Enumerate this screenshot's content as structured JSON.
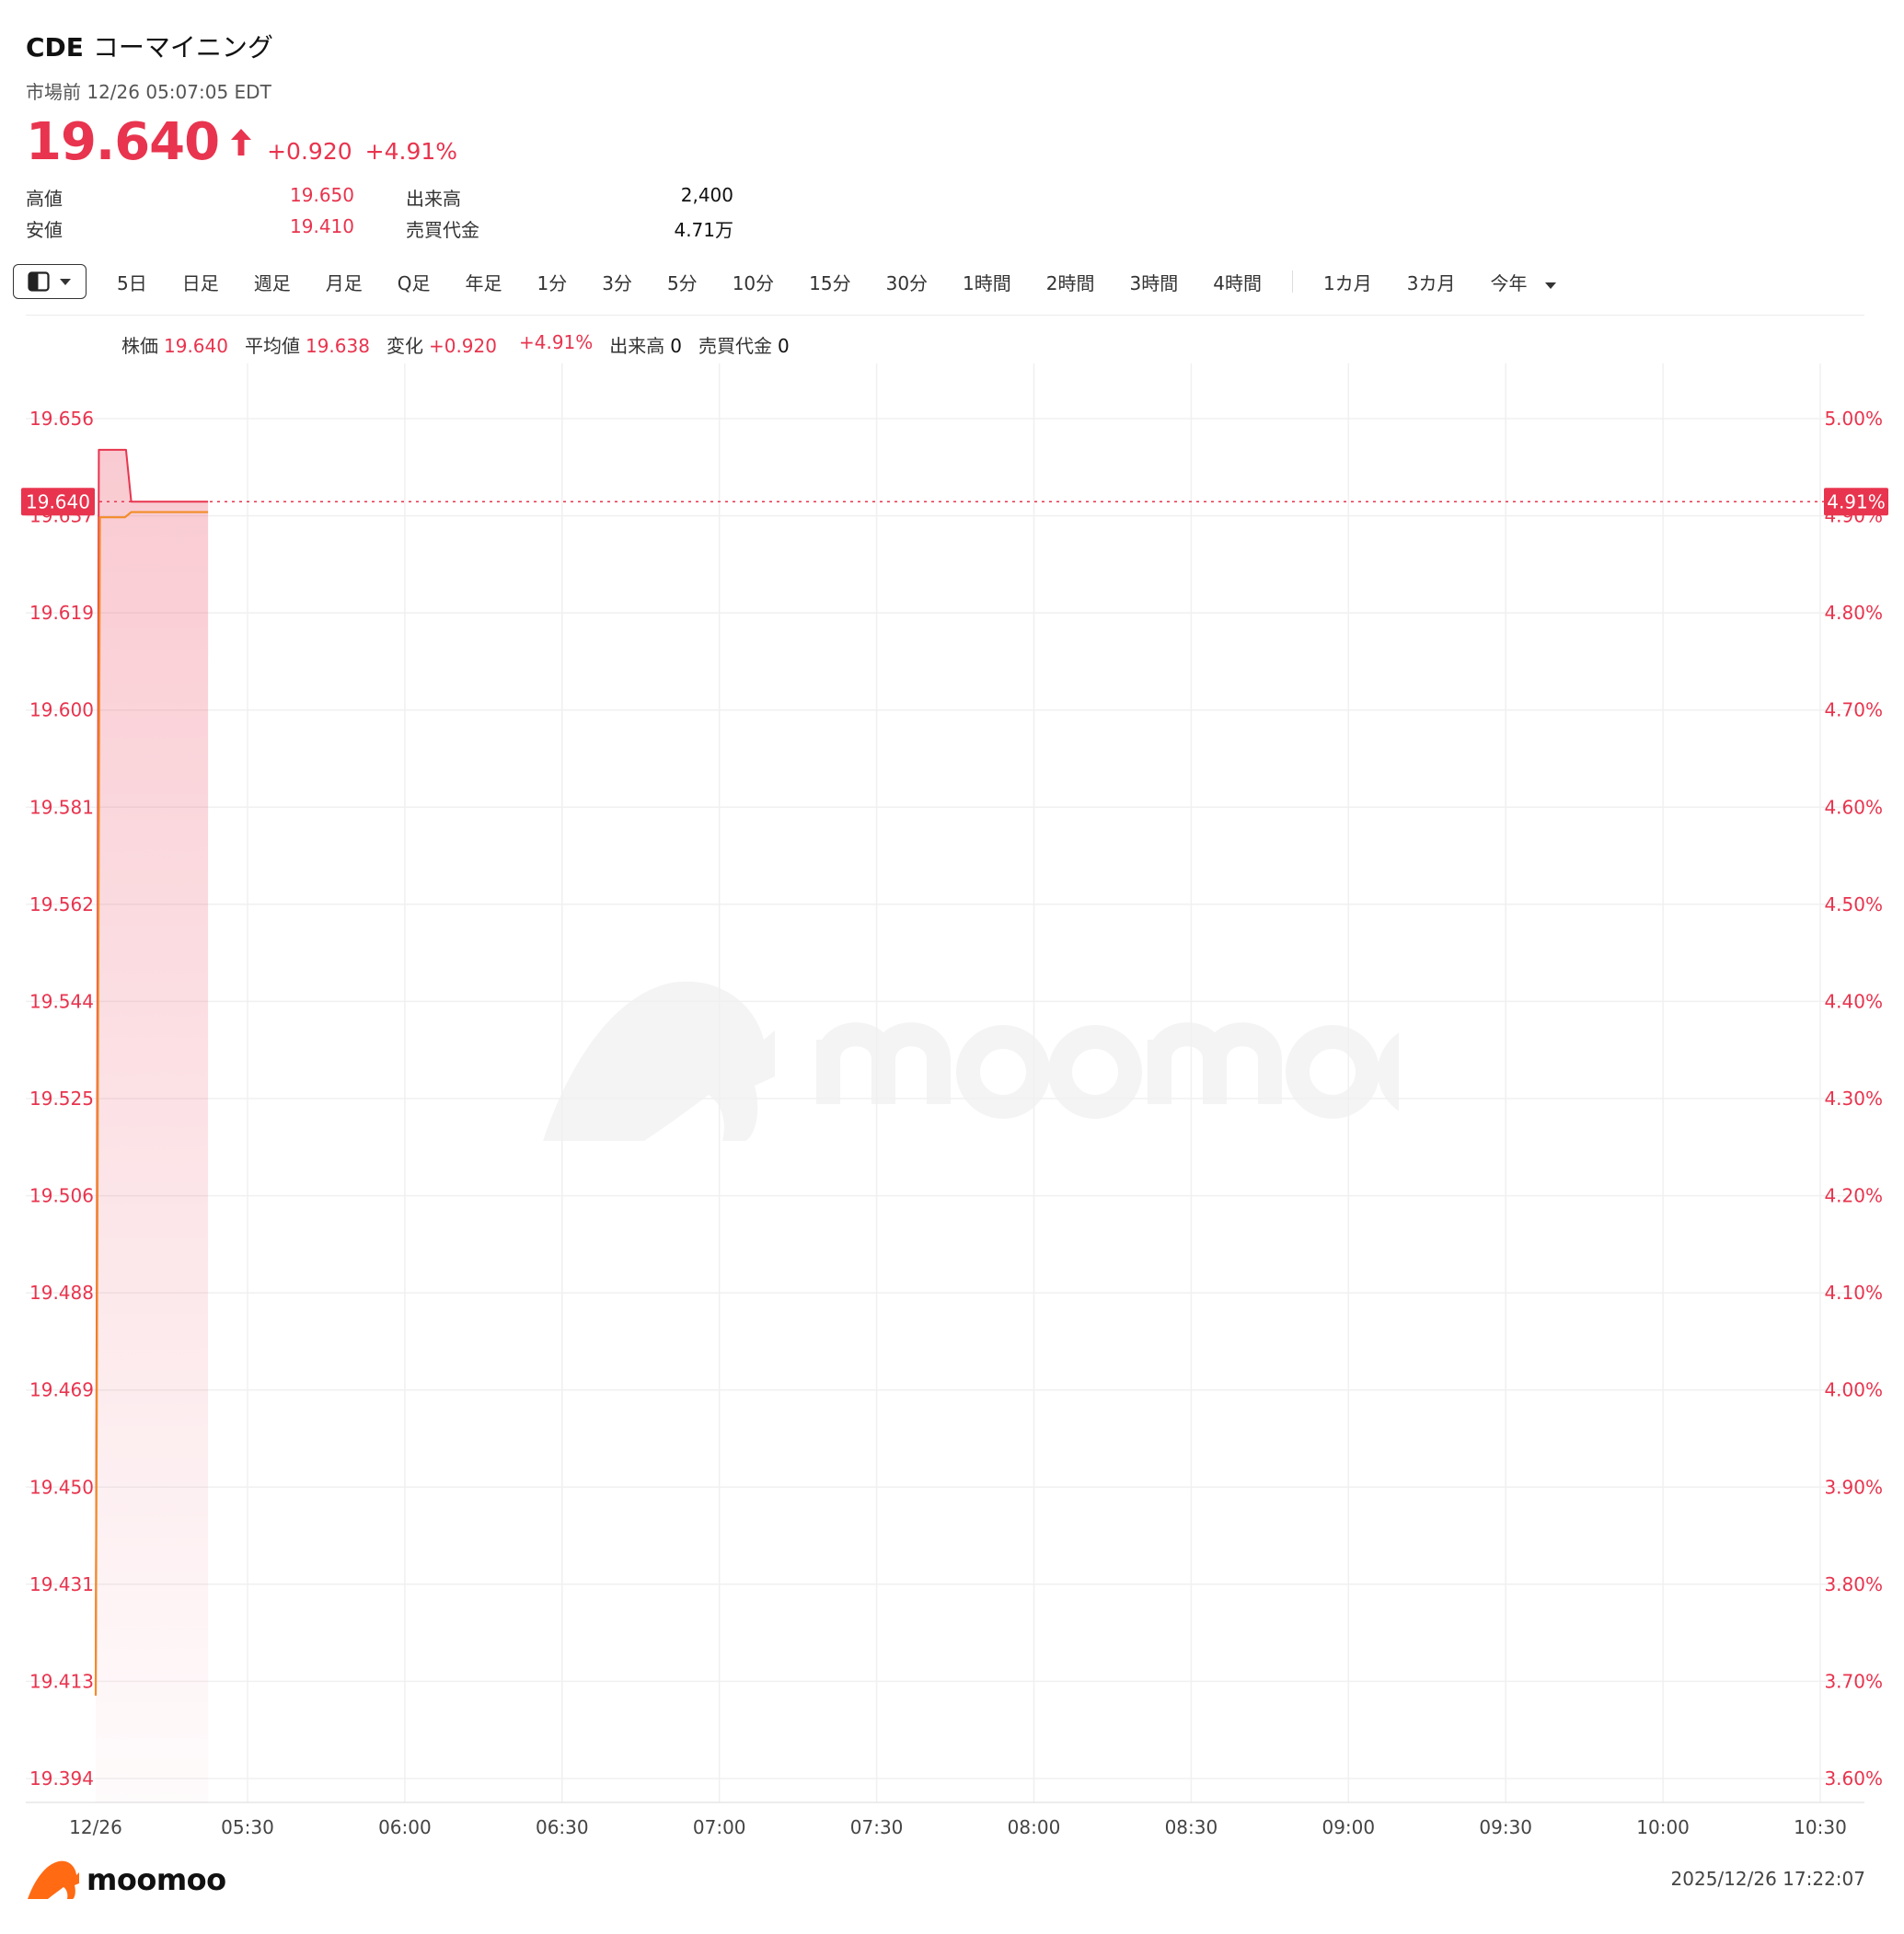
{
  "header": {
    "ticker": "CDE",
    "name": "コーマイニング",
    "session": "市場前 12/26 05:07:05 EDT",
    "price": "19.640",
    "change": "+0.920",
    "change_pct": "+4.91%"
  },
  "stats": {
    "high_label": "高値",
    "high": "19.650",
    "low_label": "安値",
    "low": "19.410",
    "volume_label": "出来高",
    "volume": "2,400",
    "turnover_label": "売買代金",
    "turnover": "4.71万"
  },
  "toolbar": {
    "items": [
      "5日",
      "日足",
      "週足",
      "月足",
      "Q足",
      "年足",
      "1分",
      "3分",
      "5分",
      "10分",
      "15分",
      "30分",
      "1時間",
      "2時間",
      "3時間",
      "4時間"
    ],
    "ranges": [
      "1カ月",
      "3カ月"
    ],
    "dropdown": "今年"
  },
  "legend": {
    "price_label": "株価",
    "price": "19.640",
    "avg_label": "平均値",
    "avg": "19.638",
    "change_label": "変化",
    "change": "+0.920",
    "change_pct": "+4.91%",
    "volume_label": "出来高",
    "volume": "0",
    "turnover_label": "売買代金",
    "turnover": "0"
  },
  "colors": {
    "up": "#e8344e",
    "avg_line": "#f28c28",
    "grid": "#f0f0f0"
  },
  "chart_data": {
    "type": "line",
    "y_left_ticks": [
      "19.656",
      "19.637",
      "19.619",
      "19.600",
      "19.581",
      "19.562",
      "19.544",
      "19.525",
      "19.506",
      "19.488",
      "19.469",
      "19.450",
      "19.431",
      "19.413",
      "19.394"
    ],
    "y_right_ticks": [
      "5.00%",
      "4.90%",
      "4.80%",
      "4.70%",
      "4.60%",
      "4.50%",
      "4.40%",
      "4.30%",
      "4.20%",
      "4.10%",
      "4.00%",
      "3.90%",
      "3.80%",
      "3.70%",
      "3.60%"
    ],
    "ylim": [
      19.394,
      19.656
    ],
    "x_ticks": [
      "12/26",
      "05:30",
      "06:00",
      "06:30",
      "07:00",
      "07:30",
      "08:00",
      "08:30",
      "09:00",
      "09:30",
      "10:00",
      "10:30"
    ],
    "xlim_minutes": [
      0,
      330
    ],
    "current_price_label": "19.640",
    "current_pct_label": "4.91%",
    "current_price": 19.64,
    "series": [
      {
        "values": [
          {
            "x": 0,
            "y": 19.41
          },
          {
            "x": 0.6,
            "y": 19.65
          },
          {
            "x": 5.8,
            "y": 19.65
          },
          {
            "x": 6.8,
            "y": 19.64
          },
          {
            "x": 21.5,
            "y": 19.64
          }
        ]
      },
      {
        "values": [
          {
            "x": 0,
            "y": 19.41
          },
          {
            "x": 0.8,
            "y": 19.637
          },
          {
            "x": 5.6,
            "y": 19.637
          },
          {
            "x": 6.8,
            "y": 19.638
          },
          {
            "x": 21.5,
            "y": 19.638
          }
        ]
      }
    ]
  },
  "footer": {
    "brand": "moomoo",
    "timestamp": "2025/12/26 17:22:07"
  }
}
